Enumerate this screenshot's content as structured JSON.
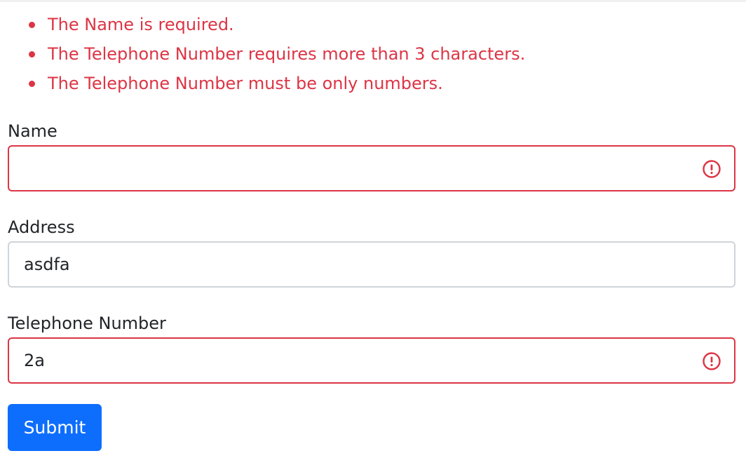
{
  "errors": [
    "The Name is required.",
    "The Telephone Number requires more than 3 characters.",
    "The Telephone Number must be only numbers."
  ],
  "fields": {
    "name": {
      "label": "Name",
      "value": ""
    },
    "address": {
      "label": "Address",
      "value": "asdfa"
    },
    "telephone": {
      "label": "Telephone Number",
      "value": "2a"
    }
  },
  "submit_label": "Submit",
  "colors": {
    "error": "#dc3545",
    "primary": "#0d6efd",
    "border": "#ced4da",
    "text": "#212529"
  },
  "icons": {
    "invalid": "exclamation-circle-icon"
  }
}
